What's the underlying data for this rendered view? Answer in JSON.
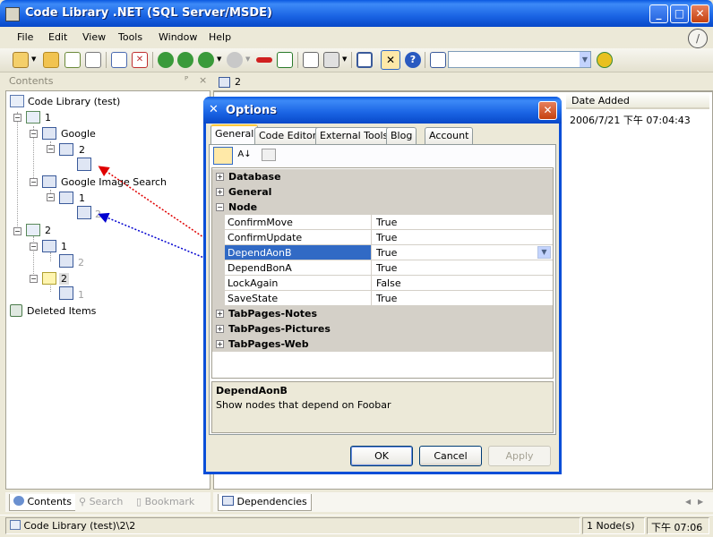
{
  "window": {
    "title": "Code Library .NET (SQL Server/MSDE)",
    "caption_buttons": [
      "minimize",
      "maximize",
      "close"
    ]
  },
  "menu": [
    "File",
    "Edit",
    "View",
    "Tools",
    "Window",
    "Help"
  ],
  "toolbar": {
    "icons": [
      "new-icon",
      "open-icon",
      "refresh-icon",
      "copy-icon",
      "paste-icon",
      "delete-icon",
      "back-icon",
      "forward-icon",
      "prev-icon",
      "next-icon",
      "cut-line-icon",
      "import-icon",
      "export-icon",
      "print-icon",
      "fullscreen-icon",
      "options-icon",
      "help-icon",
      "database-icon"
    ],
    "combo_value": ""
  },
  "left_panel": {
    "header": "Contents",
    "pin": "ᴾ",
    "close": "×",
    "tree": {
      "root": "Code Library (test)",
      "n1": "1",
      "google": "Google",
      "google_2": "2",
      "google_image_search": "Google Image Search",
      "gis_1": "1",
      "gis_1_child": "2",
      "n2": "2",
      "n2_1": "1",
      "n2_1_child": "2",
      "n2_2": "2",
      "n2_2_child": "1",
      "deleted": "Deleted Items"
    },
    "tabs": [
      "Contents",
      "Search",
      "Bookmark"
    ]
  },
  "right_panel": {
    "tab": "2",
    "column": "Date Added",
    "row_date": "2006/7/21 下午 07:04:43",
    "bottom_tab": "Dependencies"
  },
  "status": {
    "path": "Code Library (test)\\2\\2",
    "nodes": "1 Node(s)",
    "time": "下午 07:06"
  },
  "dialog": {
    "title": "Options",
    "tabs": [
      "General",
      "Code Editor",
      "External Tools",
      "Blog",
      "Account"
    ],
    "active_tab": "General",
    "categories": {
      "database": "Database",
      "general": "General",
      "node": "Node",
      "tabpages_notes": "TabPages-Notes",
      "tabpages_pictures": "TabPages-Pictures",
      "tabpages_web": "TabPages-Web"
    },
    "properties": [
      {
        "name": "ConfirmMove",
        "value": "True"
      },
      {
        "name": "ConfirmUpdate",
        "value": "True"
      },
      {
        "name": "DependAonB",
        "value": "True"
      },
      {
        "name": "DependBonA",
        "value": "True"
      },
      {
        "name": "LockAgain",
        "value": "False"
      },
      {
        "name": "SaveState",
        "value": "True"
      }
    ],
    "selected_property": "DependAonB",
    "description_title": "DependAonB",
    "description_text": "Show nodes that depend on Foobar",
    "buttons": {
      "ok": "OK",
      "cancel": "Cancel",
      "apply": "Apply"
    }
  },
  "colors": {
    "title_blue": "#0a58e0",
    "selection": "#316ac5",
    "arrow_red": "#e00000",
    "arrow_blue": "#0000d0"
  }
}
